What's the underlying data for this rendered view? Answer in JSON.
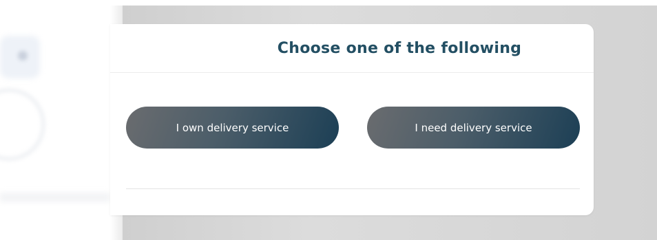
{
  "dialog": {
    "title": "Choose one of the following",
    "options": [
      {
        "label": "I own delivery service"
      },
      {
        "label": "I need delivery service"
      }
    ]
  },
  "colors": {
    "title": "#234f63",
    "button_gradient_start": "#6a6c6f",
    "button_gradient_end": "#1c3f55",
    "overlay": "#d3d3d3"
  }
}
